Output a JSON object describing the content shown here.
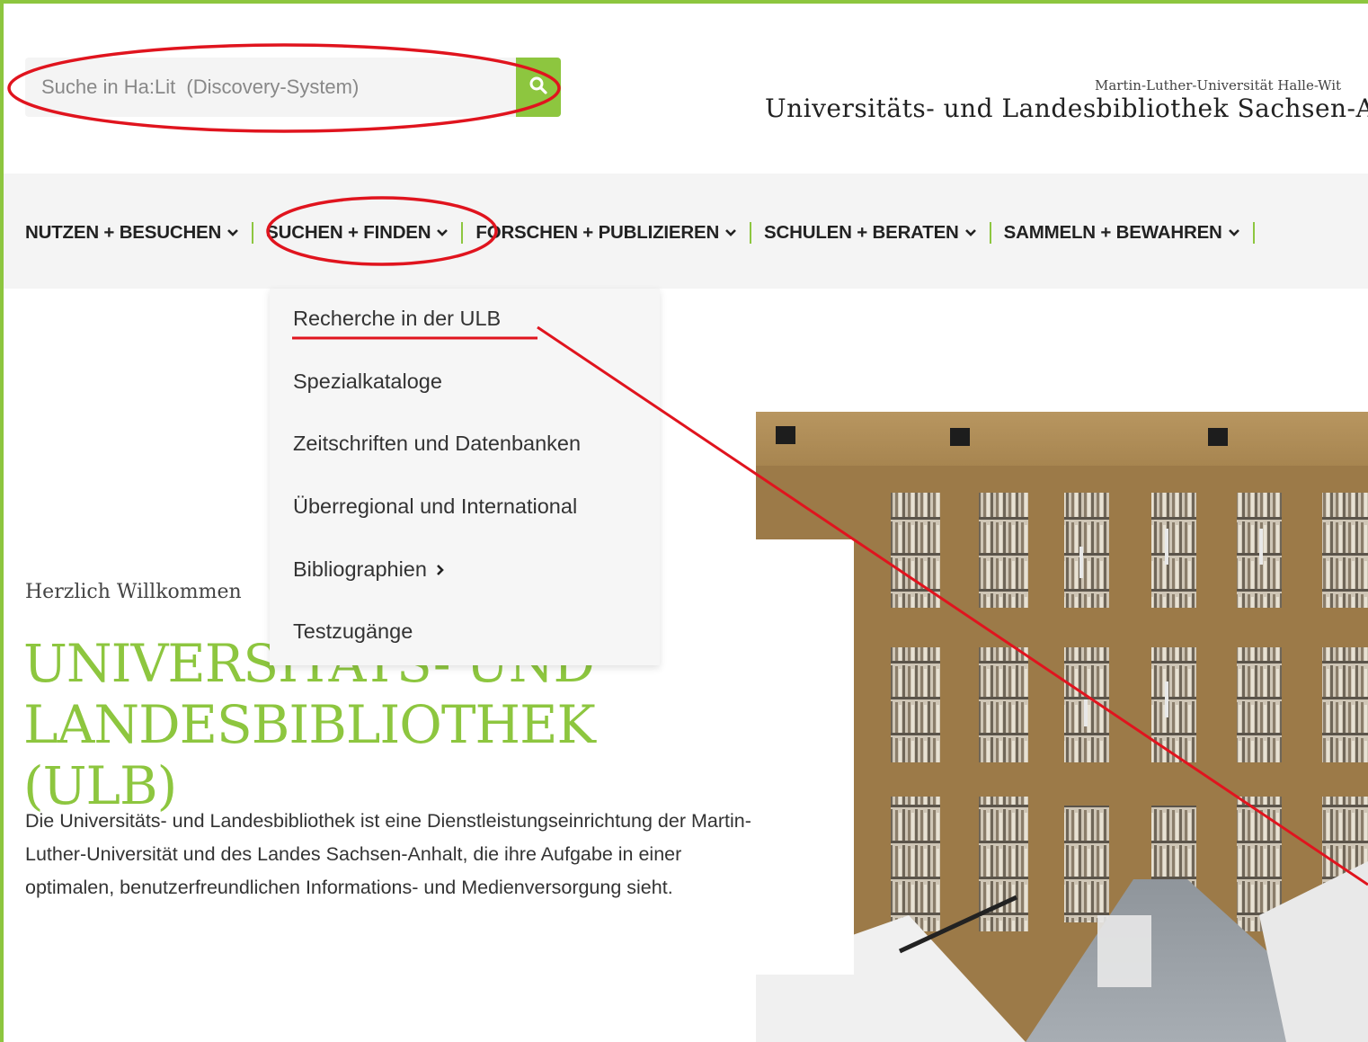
{
  "header": {
    "search_placeholder": "Suche in Ha:Lit  (Discovery-System)",
    "university_name": "Martin-Luther-Universität Halle-Wit",
    "library_name": "Universitäts- und Landesbibliothek Sachsen-An"
  },
  "nav": {
    "items": [
      {
        "label": "NUTZEN + BESUCHEN"
      },
      {
        "label": "SUCHEN + FINDEN"
      },
      {
        "label": "FORSCHEN + PUBLIZIEREN"
      },
      {
        "label": "SCHULEN + BERATEN"
      },
      {
        "label": "SAMMELN + BEWAHREN"
      }
    ]
  },
  "dropdown": {
    "items": [
      {
        "label": "Recherche in der ULB"
      },
      {
        "label": "Spezialkataloge"
      },
      {
        "label": "Zeitschriften und Datenbanken"
      },
      {
        "label": "Überregional und International"
      },
      {
        "label": "Bibliographien"
      },
      {
        "label": "Testzugänge"
      }
    ]
  },
  "hero": {
    "welcome": "Herzlich Willkommen",
    "title": "UNIVERSITÄTS- UND LANDESBIBLIOTHEK (ULB)",
    "description": "Die Universitäts- und Landesbibliothek ist eine Dienstleistungseinrichtung der Martin-Luther-Universität und des Landes Sachsen-Anhalt, die ihre Aufgabe in einer optimalen, benutzerfreundlichen Informations- und Medienversorgung sieht."
  },
  "icons": {
    "search": "search-icon",
    "nav_chevron": "chevron-down-icon",
    "submenu_chevron": "chevron-right-icon"
  },
  "colors": {
    "accent": "#8dc63f",
    "annotation": "#e0141e",
    "nav_bg": "#f4f4f4"
  }
}
